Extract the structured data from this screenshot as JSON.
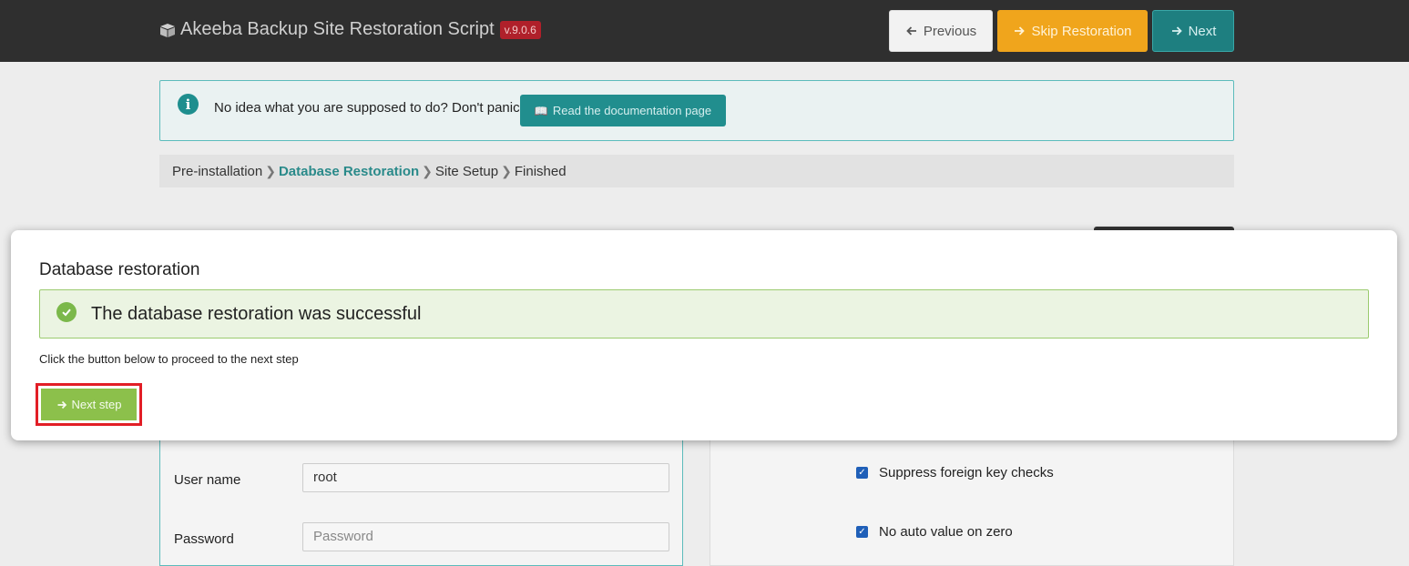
{
  "header": {
    "title": "Akeeba Backup Site Restoration Script",
    "version": "v.9.0.6",
    "buttons": {
      "previous": "Previous",
      "skip": "Skip Restoration",
      "next": "Next"
    },
    "colors": {
      "skip": "#f0a51c",
      "next": "#1e7f80",
      "version_badge": "#b0202a"
    }
  },
  "info": {
    "text": "No idea what you are supposed to do? Don't panic!",
    "button_label": "Read the documentation page"
  },
  "breadcrumb": {
    "items": [
      "Pre-installation",
      "Database Restoration",
      "Site Setup",
      "Finished"
    ],
    "active_index": 1
  },
  "form": {
    "username_label": "User name",
    "username_value": "root",
    "password_label": "Password",
    "password_placeholder": "Password"
  },
  "options": {
    "suppress_fk": {
      "label": "Suppress foreign key checks",
      "checked": true
    },
    "no_auto_value": {
      "label": "No auto value on zero",
      "checked": true
    }
  },
  "modal": {
    "title": "Database restoration",
    "success_message": "The database restoration was successful",
    "instruction": "Click the button below to proceed to the next step",
    "next_step_label": "Next step",
    "colors": {
      "success_bg": "#ebf4e2",
      "next_step": "#8cc04b",
      "highlight": "#e21e26"
    }
  }
}
